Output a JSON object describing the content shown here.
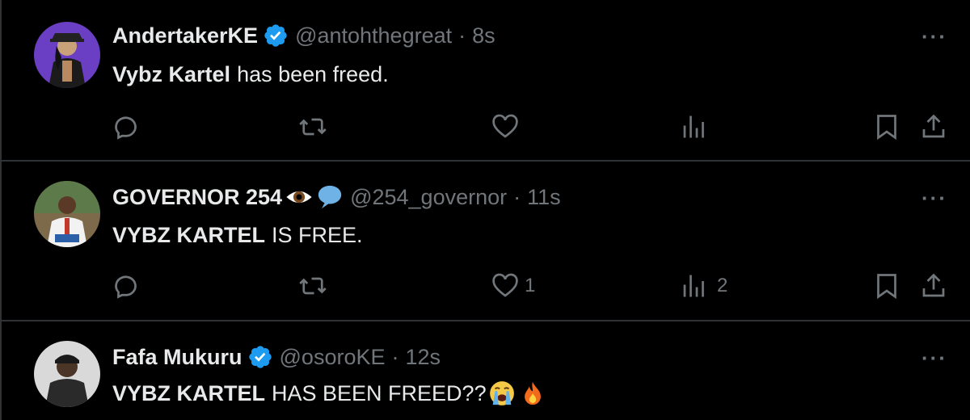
{
  "tweets": [
    {
      "name": "AndertakerKE",
      "handle": "@antohthegreat",
      "dot": "·",
      "time": "8s",
      "text_bold": "Vybz Kartel",
      "text_rest": "has been freed.",
      "verified": true,
      "replies": "",
      "retweets": "",
      "likes": "",
      "views": ""
    },
    {
      "name": "GOVERNOR 254",
      "handle": "@254_governor",
      "dot": "·",
      "time": "11s",
      "text_bold": "VYBZ KARTEL",
      "text_rest": "IS FREE.",
      "name_emojis": [
        "eye-emoji",
        "speech-bubble-emoji"
      ],
      "replies": "",
      "retweets": "",
      "likes": "1",
      "views": "2"
    },
    {
      "name": "Fafa Mukuru",
      "handle": "@osoroKE",
      "dot": "·",
      "time": "12s",
      "text_bold": "VYBZ KARTEL",
      "text_rest": "HAS BEEN FREED??",
      "text_emojis": [
        "loudly-crying-face-emoji",
        "fire-emoji"
      ],
      "verified": true
    }
  ],
  "more_label": "···",
  "colors": {
    "background": "#000000",
    "primary_text": "#e7e9ea",
    "secondary_text": "#71767b",
    "verified": "#1d9bf0",
    "divider": "#2f3336"
  }
}
